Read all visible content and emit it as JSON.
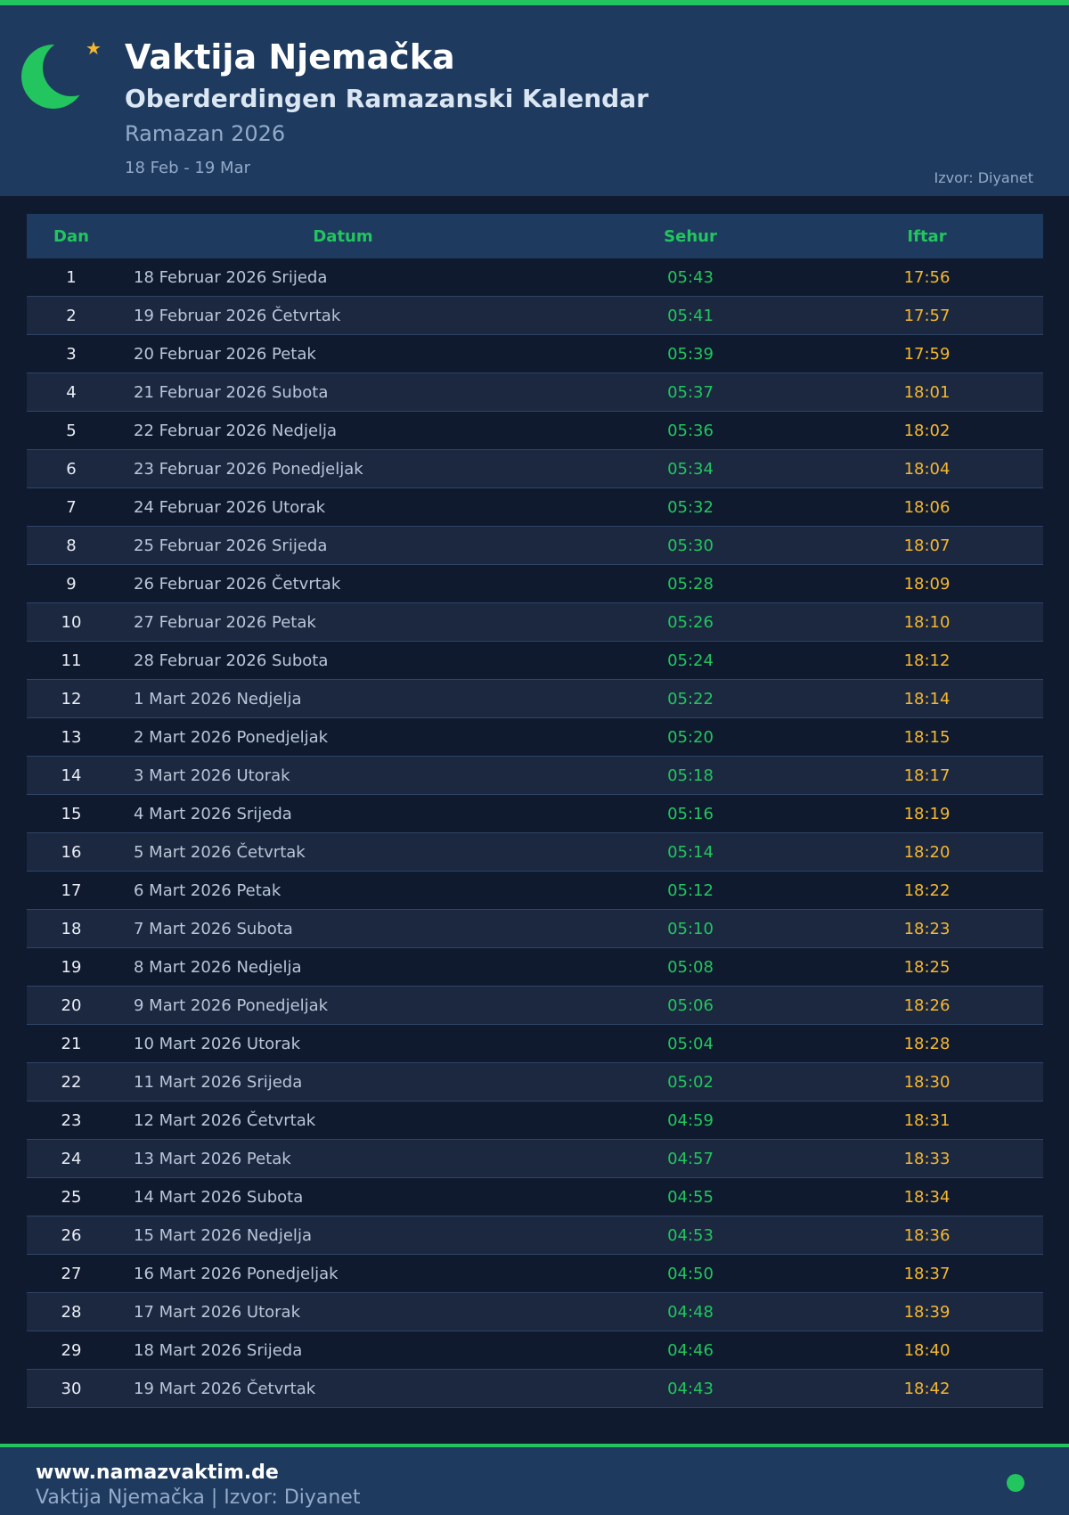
{
  "header": {
    "title": "Vaktija Njemačka",
    "subtitle": "Oberderdingen Ramazanski Kalendar",
    "year_label": "Ramazan 2026",
    "date_range": "18 Feb - 19 Mar",
    "source": "Izvor: Diyanet",
    "logo_icon": "crescent-moon-icon",
    "star_icon": "star-icon",
    "colors": {
      "accent": "#22c55e",
      "gold": "#f5b731",
      "header_bg": "#1e3a5f",
      "page_bg": "#0f1a2e"
    }
  },
  "table": {
    "columns": {
      "dan": "Dan",
      "datum": "Datum",
      "sehur": "Sehur",
      "iftar": "Iftar"
    },
    "rows": [
      {
        "dan": "1",
        "datum": "18 Februar 2026 Srijeda",
        "sehur": "05:43",
        "iftar": "17:56"
      },
      {
        "dan": "2",
        "datum": "19 Februar 2026 Četvrtak",
        "sehur": "05:41",
        "iftar": "17:57"
      },
      {
        "dan": "3",
        "datum": "20 Februar 2026 Petak",
        "sehur": "05:39",
        "iftar": "17:59"
      },
      {
        "dan": "4",
        "datum": "21 Februar 2026 Subota",
        "sehur": "05:37",
        "iftar": "18:01"
      },
      {
        "dan": "5",
        "datum": "22 Februar 2026 Nedjelja",
        "sehur": "05:36",
        "iftar": "18:02"
      },
      {
        "dan": "6",
        "datum": "23 Februar 2026 Ponedjeljak",
        "sehur": "05:34",
        "iftar": "18:04"
      },
      {
        "dan": "7",
        "datum": "24 Februar 2026 Utorak",
        "sehur": "05:32",
        "iftar": "18:06"
      },
      {
        "dan": "8",
        "datum": "25 Februar 2026 Srijeda",
        "sehur": "05:30",
        "iftar": "18:07"
      },
      {
        "dan": "9",
        "datum": "26 Februar 2026 Četvrtak",
        "sehur": "05:28",
        "iftar": "18:09"
      },
      {
        "dan": "10",
        "datum": "27 Februar 2026 Petak",
        "sehur": "05:26",
        "iftar": "18:10"
      },
      {
        "dan": "11",
        "datum": "28 Februar 2026 Subota",
        "sehur": "05:24",
        "iftar": "18:12"
      },
      {
        "dan": "12",
        "datum": "1 Mart 2026 Nedjelja",
        "sehur": "05:22",
        "iftar": "18:14"
      },
      {
        "dan": "13",
        "datum": "2 Mart 2026 Ponedjeljak",
        "sehur": "05:20",
        "iftar": "18:15"
      },
      {
        "dan": "14",
        "datum": "3 Mart 2026 Utorak",
        "sehur": "05:18",
        "iftar": "18:17"
      },
      {
        "dan": "15",
        "datum": "4 Mart 2026 Srijeda",
        "sehur": "05:16",
        "iftar": "18:19"
      },
      {
        "dan": "16",
        "datum": "5 Mart 2026 Četvrtak",
        "sehur": "05:14",
        "iftar": "18:20"
      },
      {
        "dan": "17",
        "datum": "6 Mart 2026 Petak",
        "sehur": "05:12",
        "iftar": "18:22"
      },
      {
        "dan": "18",
        "datum": "7 Mart 2026 Subota",
        "sehur": "05:10",
        "iftar": "18:23"
      },
      {
        "dan": "19",
        "datum": "8 Mart 2026 Nedjelja",
        "sehur": "05:08",
        "iftar": "18:25"
      },
      {
        "dan": "20",
        "datum": "9 Mart 2026 Ponedjeljak",
        "sehur": "05:06",
        "iftar": "18:26"
      },
      {
        "dan": "21",
        "datum": "10 Mart 2026 Utorak",
        "sehur": "05:04",
        "iftar": "18:28"
      },
      {
        "dan": "22",
        "datum": "11 Mart 2026 Srijeda",
        "sehur": "05:02",
        "iftar": "18:30"
      },
      {
        "dan": "23",
        "datum": "12 Mart 2026 Četvrtak",
        "sehur": "04:59",
        "iftar": "18:31"
      },
      {
        "dan": "24",
        "datum": "13 Mart 2026 Petak",
        "sehur": "04:57",
        "iftar": "18:33"
      },
      {
        "dan": "25",
        "datum": "14 Mart 2026 Subota",
        "sehur": "04:55",
        "iftar": "18:34"
      },
      {
        "dan": "26",
        "datum": "15 Mart 2026 Nedjelja",
        "sehur": "04:53",
        "iftar": "18:36"
      },
      {
        "dan": "27",
        "datum": "16 Mart 2026 Ponedjeljak",
        "sehur": "04:50",
        "iftar": "18:37"
      },
      {
        "dan": "28",
        "datum": "17 Mart 2026 Utorak",
        "sehur": "04:48",
        "iftar": "18:39"
      },
      {
        "dan": "29",
        "datum": "18 Mart 2026 Srijeda",
        "sehur": "04:46",
        "iftar": "18:40"
      },
      {
        "dan": "30",
        "datum": "19 Mart 2026 Četvrtak",
        "sehur": "04:43",
        "iftar": "18:42"
      }
    ]
  },
  "footer": {
    "website": "www.namazvaktim.de",
    "credit": "Vaktija Njemačka | Izvor: Diyanet",
    "status_icon": "status-dot-icon"
  }
}
